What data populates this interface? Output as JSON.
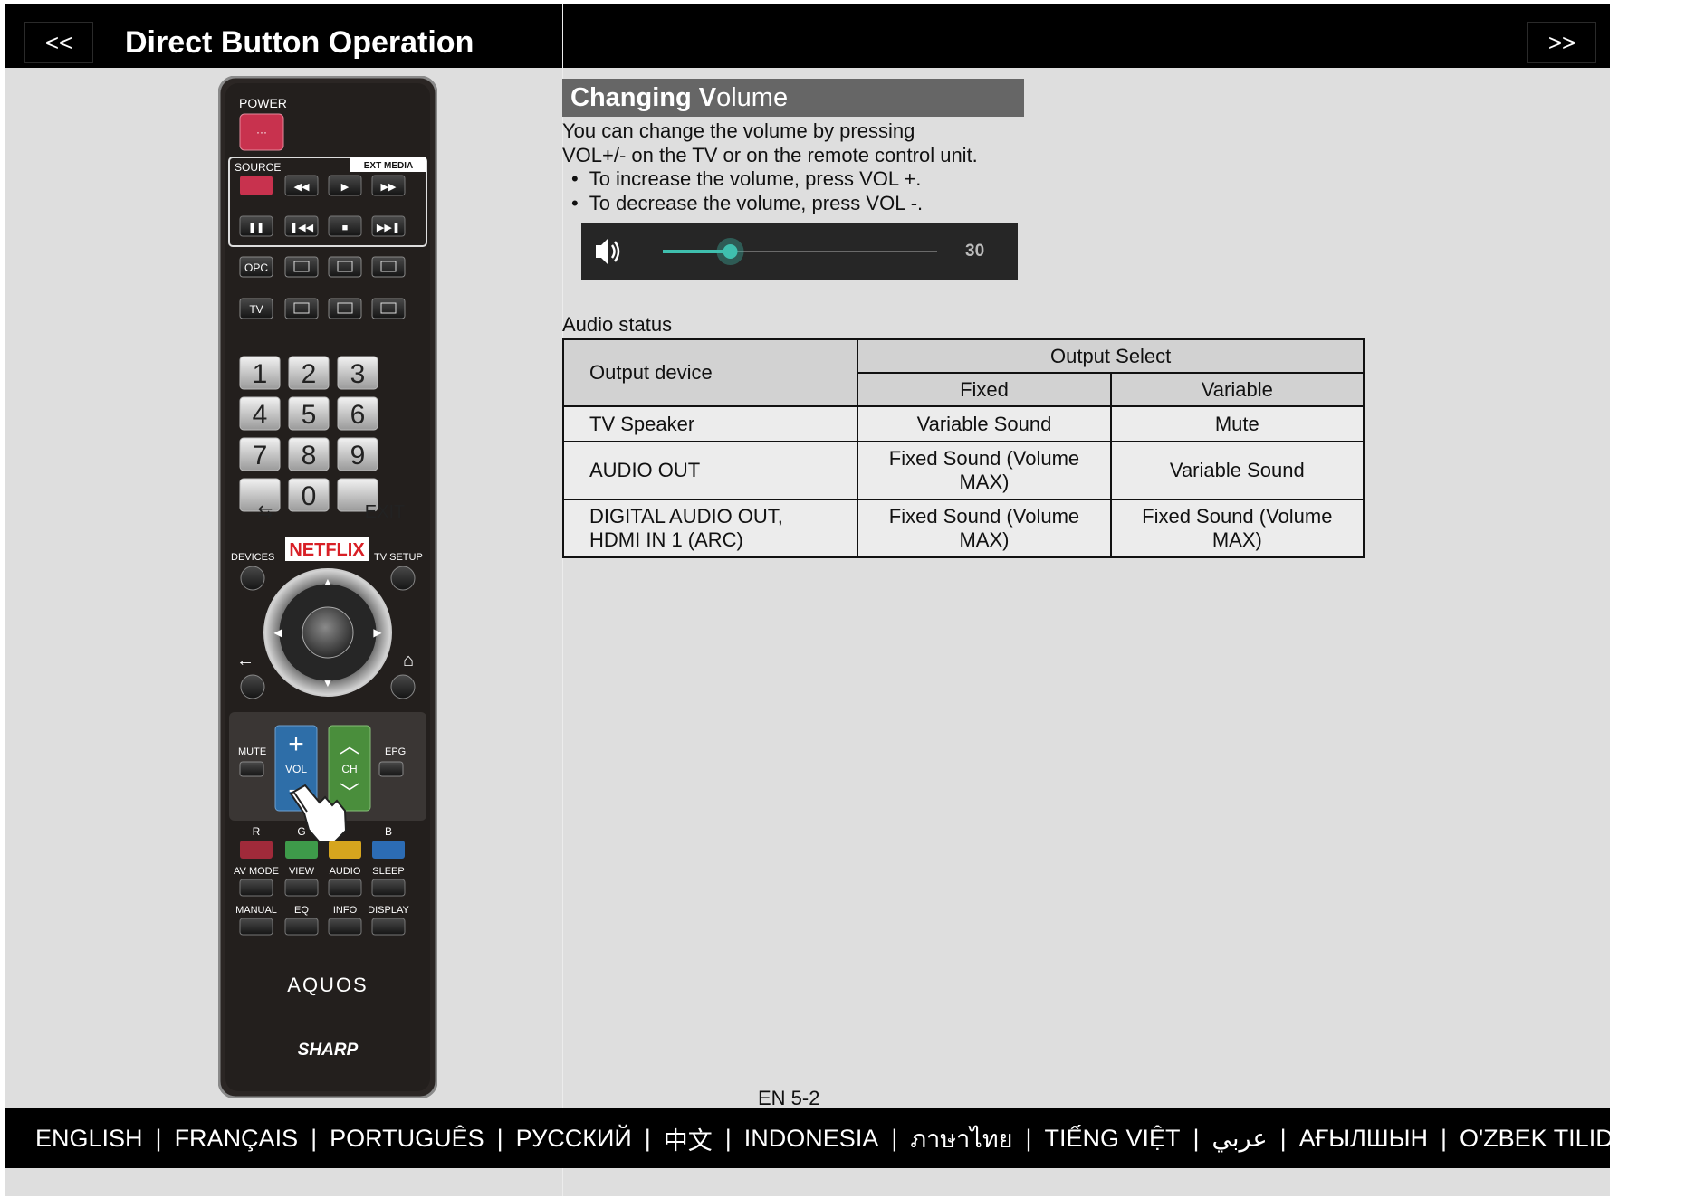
{
  "header": {
    "title": "Direct Button Operation",
    "prev_label": "<<",
    "next_label": ">>"
  },
  "remote": {
    "labels": {
      "power": "POWER",
      "source": "SOURCE",
      "ext_media": "EXT MEDIA",
      "opc": "OPC",
      "tv": "TV",
      "exit": "EXIT",
      "netflix": "NETFLIX",
      "devices": "DEVICES",
      "tv_setup": "TV SETUP",
      "mute": "MUTE",
      "vol": "VOL",
      "ch": "CH",
      "epg": "EPG",
      "r": "R",
      "g": "G",
      "b": "B",
      "av_mode": "AV MODE",
      "view": "VIEW",
      "audio": "AUDIO",
      "sleep": "SLEEP",
      "manual": "MANUAL",
      "eq": "EQ",
      "info": "INFO",
      "display": "DISPLAY",
      "aquos": "AQUOS",
      "sharp": "SHARP"
    },
    "digits": [
      "1",
      "2",
      "3",
      "4",
      "5",
      "6",
      "7",
      "8",
      "9",
      "0"
    ],
    "colors": {
      "body": "#2b2624",
      "power": "#c8324e",
      "vol": "#2e6ea8",
      "ch": "#4a8e3c",
      "red": "#a02a3a",
      "green": "#3e9a4a",
      "yellow": "#d6a51e",
      "blue": "#2c6cb4"
    }
  },
  "section": {
    "heading_bold": "Changing V",
    "heading_rest": "olume",
    "intro_line1": "You can change the volume by pressing",
    "intro_line2": "VOL+/- on the TV or on the remote control unit.",
    "bullets": [
      "To increase the volume, press VOL +.",
      "To decrease the volume, press VOL -."
    ],
    "volume_level": "30",
    "volume_fraction": 0.3
  },
  "audio_status": {
    "label": "Audio status",
    "col_device": "Output device",
    "col_output_select": "Output Select",
    "col_fixed": "Fixed",
    "col_variable": "Variable",
    "rows": [
      {
        "device": "TV Speaker",
        "fixed": "Variable Sound",
        "variable": "Mute"
      },
      {
        "device": "AUDIO OUT",
        "fixed_line1": "Fixed Sound (Volume",
        "fixed_line2": "MAX)",
        "variable": "Variable Sound"
      },
      {
        "device_line1": "DIGITAL AUDIO OUT,",
        "device_line2": "HDMI IN 1 (ARC)",
        "fixed_line1": "Fixed Sound (Volume",
        "fixed_line2": "MAX)",
        "variable_line1": "Fixed Sound (Volume",
        "variable_line2": "MAX)"
      }
    ]
  },
  "page_number": "EN 5-2",
  "languages": [
    "ENGLISH",
    "FRANÇAIS",
    "PORTUGUÊS",
    "РУССКИЙ",
    "中文",
    "INDONESIA",
    "ภาษาไทย",
    "TIẾNG VIỆT",
    "عربي",
    "АҒЫЛШЫН",
    "O'ZBEK TILIDA"
  ],
  "language_separator": "|"
}
